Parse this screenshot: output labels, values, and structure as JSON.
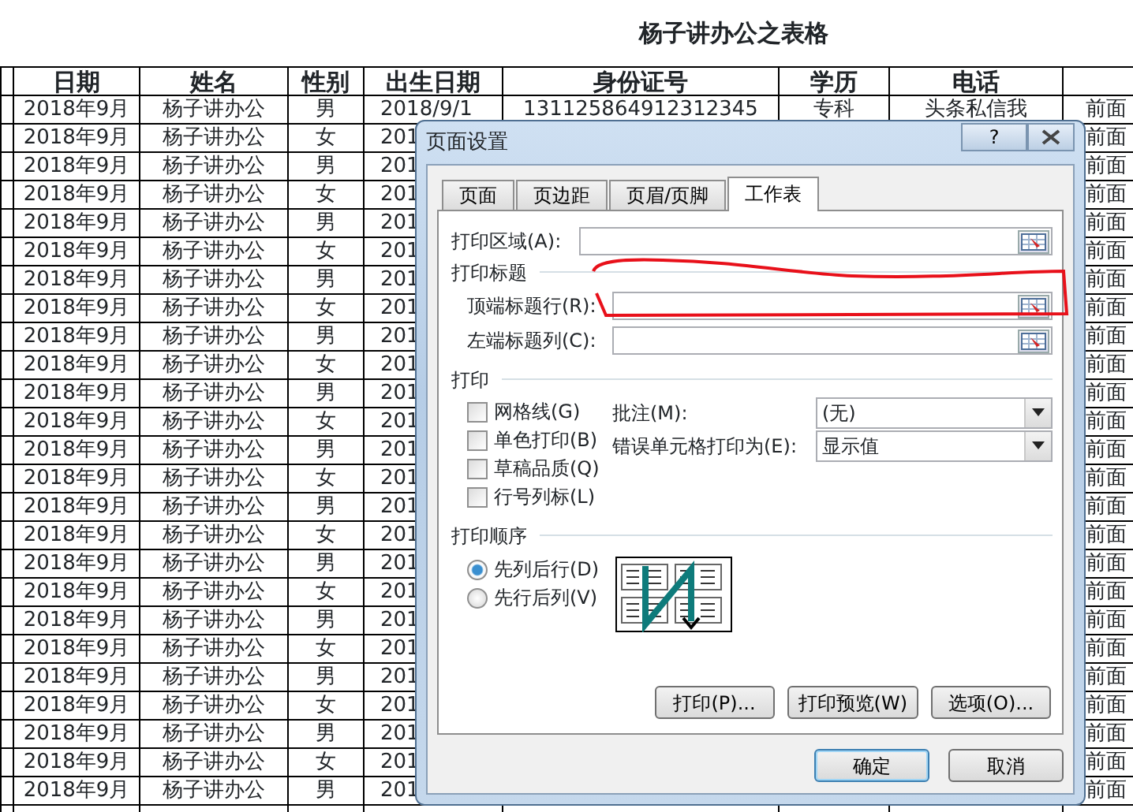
{
  "sheet": {
    "title": "杨子讲办公之表格",
    "columns": [
      "日期",
      "姓名",
      "性别",
      "出生日期",
      "身份证号",
      "学历",
      "电话"
    ],
    "rows": [
      {
        "date": "2018年9月",
        "name": "杨子讲办公",
        "gender": "男",
        "birth": "2018/9/1",
        "id": "131125864912312345",
        "education": "专科",
        "phone": "头条私信我",
        "column_8": "前面"
      },
      {
        "date": "2018年9月",
        "name": "杨子讲办公",
        "gender": "女",
        "birth": "201",
        "column_8": "前面"
      },
      {
        "date": "2018年9月",
        "name": "杨子讲办公",
        "gender": "男",
        "birth": "201",
        "column_8": "前面"
      },
      {
        "date": "2018年9月",
        "name": "杨子讲办公",
        "gender": "女",
        "birth": "201",
        "column_8": "前面"
      },
      {
        "date": "2018年9月",
        "name": "杨子讲办公",
        "gender": "男",
        "birth": "201",
        "column_8": "前面"
      },
      {
        "date": "2018年9月",
        "name": "杨子讲办公",
        "gender": "女",
        "birth": "201",
        "column_8": "前面"
      },
      {
        "date": "2018年9月",
        "name": "杨子讲办公",
        "gender": "男",
        "birth": "201",
        "column_8": "前面"
      },
      {
        "date": "2018年9月",
        "name": "杨子讲办公",
        "gender": "女",
        "birth": "201",
        "column_8": "前面"
      },
      {
        "date": "2018年9月",
        "name": "杨子讲办公",
        "gender": "男",
        "birth": "201",
        "column_8": "前面"
      },
      {
        "date": "2018年9月",
        "name": "杨子讲办公",
        "gender": "女",
        "birth": "201",
        "column_8": "前面"
      },
      {
        "date": "2018年9月",
        "name": "杨子讲办公",
        "gender": "男",
        "birth": "201",
        "column_8": "前面"
      },
      {
        "date": "2018年9月",
        "name": "杨子讲办公",
        "gender": "女",
        "birth": "201",
        "column_8": "前面"
      },
      {
        "date": "2018年9月",
        "name": "杨子讲办公",
        "gender": "男",
        "birth": "201",
        "column_8": "前面"
      },
      {
        "date": "2018年9月",
        "name": "杨子讲办公",
        "gender": "女",
        "birth": "201",
        "column_8": "前面"
      },
      {
        "date": "2018年9月",
        "name": "杨子讲办公",
        "gender": "男",
        "birth": "201",
        "column_8": "前面"
      },
      {
        "date": "2018年9月",
        "name": "杨子讲办公",
        "gender": "女",
        "birth": "201",
        "column_8": "前面"
      },
      {
        "date": "2018年9月",
        "name": "杨子讲办公",
        "gender": "男",
        "birth": "201",
        "column_8": "前面"
      },
      {
        "date": "2018年9月",
        "name": "杨子讲办公",
        "gender": "女",
        "birth": "201",
        "column_8": "前面"
      },
      {
        "date": "2018年9月",
        "name": "杨子讲办公",
        "gender": "男",
        "birth": "201",
        "column_8": "前面"
      },
      {
        "date": "2018年9月",
        "name": "杨子讲办公",
        "gender": "女",
        "birth": "201",
        "column_8": "前面"
      },
      {
        "date": "2018年9月",
        "name": "杨子讲办公",
        "gender": "男",
        "birth": "201",
        "column_8": "前面"
      },
      {
        "date": "2018年9月",
        "name": "杨子讲办公",
        "gender": "女",
        "birth": "201",
        "column_8": "前面"
      },
      {
        "date": "2018年9月",
        "name": "杨子讲办公",
        "gender": "男",
        "birth": "201",
        "column_8": "前面"
      },
      {
        "date": "2018年9月",
        "name": "杨子讲办公",
        "gender": "女",
        "birth": "201",
        "column_8": "前面"
      },
      {
        "date": "2018年9月",
        "name": "杨子讲办公",
        "gender": "男",
        "birth": "201",
        "column_8": "前面"
      }
    ]
  },
  "dialog": {
    "title": "页面设置",
    "help_button": "?",
    "tabs": [
      {
        "label": "页面",
        "selected": false
      },
      {
        "label": "页边距",
        "selected": false
      },
      {
        "label": "页眉/页脚",
        "selected": false
      },
      {
        "label": "工作表",
        "selected": true
      }
    ],
    "print_area": {
      "label": "打印区域(A):"
    },
    "print_titles": {
      "heading": "打印标题",
      "rows_label": "顶端标题行(R):",
      "columns_label": "左端标题列(C):"
    },
    "print": {
      "heading": "打印",
      "checkboxes": [
        {
          "label": "网格线(G)",
          "checked": false
        },
        {
          "label": "单色打印(B)",
          "checked": false
        },
        {
          "label": "草稿品质(Q)",
          "checked": false
        },
        {
          "label": "行号列标(L)",
          "checked": false
        }
      ],
      "selects": [
        {
          "label": "批注(M):",
          "value": "(无)"
        },
        {
          "label": "错误单元格打印为(E):",
          "value": "显示值"
        }
      ]
    },
    "order": {
      "heading": "打印顺序",
      "options": [
        {
          "label": "先列后行(D)",
          "selected": true
        },
        {
          "label": "先行后列(V)",
          "selected": false
        }
      ]
    },
    "action_buttons": [
      "打印(P)...",
      "打印预览(W)",
      "选项(O)..."
    ],
    "footer_buttons": [
      {
        "label": "确定",
        "default": true
      },
      {
        "label": "取消",
        "default": false
      }
    ]
  }
}
